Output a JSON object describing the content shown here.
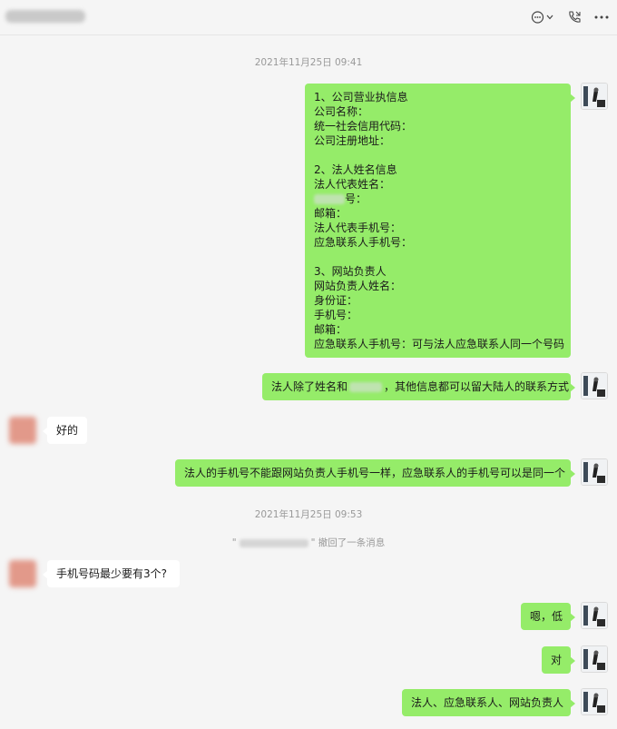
{
  "header": {
    "icons": [
      "chat-bubble-icon",
      "chevron-down-icon",
      "phone-icon",
      "more-icon"
    ]
  },
  "timestamps": [
    "2021年11月25日 09:41",
    "2021年11月25日 09:53"
  ],
  "recall": {
    "quote_open": "\"",
    "quote_close": "\"",
    "text": "撤回了一条消息"
  },
  "messages": {
    "m1_lines": [
      "1、公司营业执信息",
      "公司名称：",
      "统一社会信用代码：",
      "公司注册地址：",
      "",
      "2、法人姓名信息",
      "法人代表姓名：",
      "号：",
      "邮箱：",
      "法人代表手机号：",
      "应急联系人手机号：",
      "",
      "3、网站负责人",
      "网站负责人姓名：",
      "身份证：",
      "手机号：",
      "邮箱：",
      "应急联系人手机号：可与法人应急联系人同一个号码"
    ],
    "m2_prefix": "法人除了姓名和",
    "m2_suffix": "，其他信息都可以留大陆人的联系方式",
    "m3": "好的",
    "m4": "法人的手机号不能跟网站负责人手机号一样，应急联系人的手机号可以是同一个",
    "m5": "手机号码最少要有3个?",
    "m6": "嗯，低",
    "m7": "对",
    "m8": "法人、应急联系人、网站负责人"
  },
  "colors": {
    "self_bubble": "#95ec69",
    "other_bubble": "#ffffff",
    "background": "#f5f5f5",
    "timestamp": "#999999"
  }
}
